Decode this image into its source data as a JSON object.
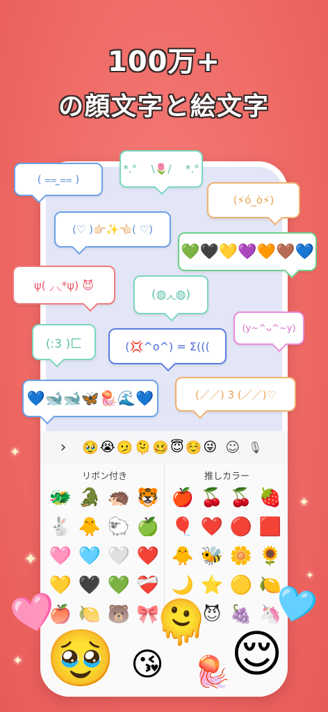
{
  "headline": {
    "line1": "100万+",
    "line2_a": "の顔文字と絵文字",
    "line2_accent": ""
  },
  "bubbles": [
    {
      "text": "( ⩵ ̫⩵ )",
      "color": "#6aa0e6",
      "textColor": "#5b8fd8"
    },
    {
      "text": "*.°  ⠀ \\🌷/ ⠀ *.°",
      "color": "#7ad6c0",
      "textColor": "#5bbfa8"
    },
    {
      "text": "(♡    )👉🏻✨👈🏻(    ♡)",
      "color": "#6aa0e6",
      "textColor": "#5b8fd8"
    },
    {
      "text": "(⚡ó_ò⚡)",
      "color": "#f0b070",
      "textColor": "#e8a050"
    },
    {
      "text": "💚🖤💛💜🧡🤎💙",
      "color": "#6fce8a",
      "textColor": "#333"
    },
    {
      "text": "ψ( ◞ ◟*ψ)  😈",
      "color": "#f07a7a",
      "textColor": "#e85a6a"
    },
    {
      "text": "(◍◞◟◍)",
      "color": "#7ad6c0",
      "textColor": "#5bbfa8"
    },
    {
      "text": "(:3 )⼕",
      "color": "#7ad6c0",
      "textColor": "#5bbfa8"
    },
    {
      "text": "(💢^o^)   = Σ(((",
      "color": "#5a7de0",
      "textColor": "#4b6bd8"
    },
    {
      "text": "(y~^ᴗ^~y)",
      "color": "#e88ad8",
      "textColor": "#d870c8"
    },
    {
      "text": "💙🐋🐋🦋🪼🌊💙",
      "color": "#6aa0e6",
      "textColor": "#333"
    },
    {
      "text": "(／／)  3  (／／)♡",
      "color": "#f0b070",
      "textColor": "#e8a050"
    }
  ],
  "toolbar": {
    "chevron": "›",
    "emojis": [
      "🥹",
      "😭",
      "🫤",
      "🫠",
      "🥴",
      "😇",
      "☺️",
      "😜"
    ],
    "emoji_icon": "☺",
    "mic_icon": "🎙"
  },
  "panel": {
    "left_title": "リボン付き",
    "right_title": "推しカラー",
    "left_emojis": [
      "🐲",
      "🐊",
      "🦔",
      "🐯",
      "🐇",
      "🐥",
      "🐑",
      "🍏",
      "🩷",
      "🩵",
      "🤍",
      "❤️",
      "💛",
      "🖤",
      "💚",
      "❤️‍🩹",
      "🍎",
      "🍋",
      "🐻",
      "🎀"
    ],
    "right_emojis": [
      "🍎",
      "🍒",
      "🍒",
      "🍓",
      "🎈",
      "❤️",
      "🔴",
      "🟥",
      "🐥",
      "🐝",
      "🌼",
      "🌻",
      "🌙",
      "⭐",
      "🟡",
      "🍋",
      "🟪",
      "😈",
      "🍇",
      "🦄"
    ]
  },
  "floating": {
    "heart_left": "🩷",
    "pleading": "🥹",
    "kiss": "😘",
    "melting": "🫠",
    "jellyfish": "🪼",
    "relieved": "😌",
    "heart_right": "🩵"
  },
  "colors": {
    "background": "#ef6b66",
    "phone": "#ffffff",
    "chat_bg": "#e3e6f6"
  }
}
